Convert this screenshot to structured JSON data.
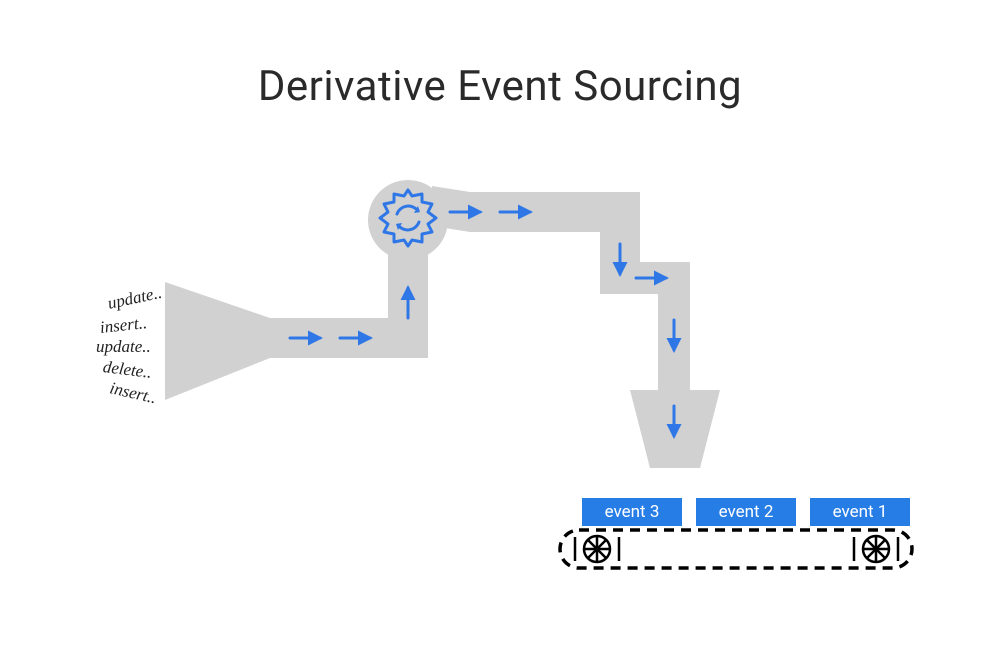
{
  "title": "Derivative Event Sourcing",
  "inputs": {
    "w1": "update..",
    "w2": "insert..",
    "w3": "update..",
    "w4": "delete..",
    "w5": "insert.."
  },
  "events": {
    "e3": "event 3",
    "e2": "event 2",
    "e1": "event 1"
  },
  "colors": {
    "pipe": "#d1d1d1",
    "arrow": "#2f77e6",
    "gear": "#2f77e6",
    "event_bg": "#267de6",
    "belt": "#000000"
  }
}
